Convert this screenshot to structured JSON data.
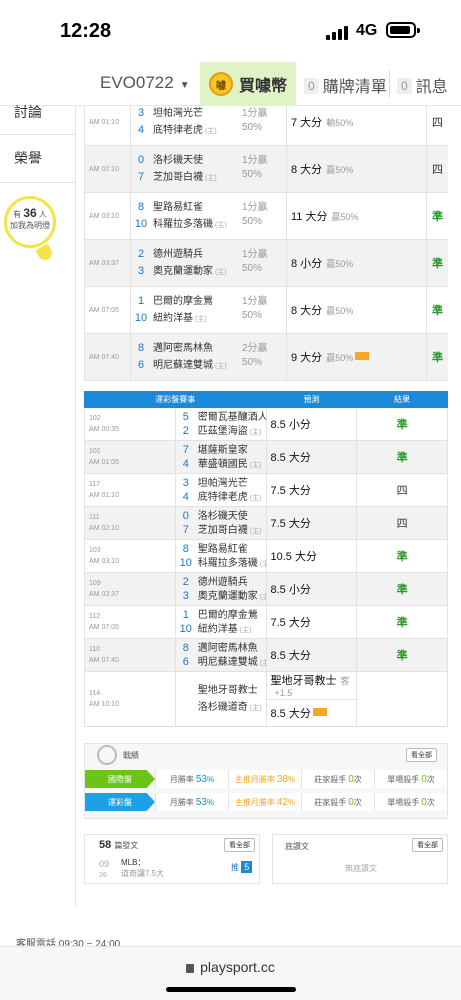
{
  "status_bar": {
    "time": "12:28",
    "network": "4G"
  },
  "top_nav": {
    "user_id": "EVO0722",
    "buy_coin_label": "買噱幣",
    "coin_glyph": "噱",
    "purchase_list": {
      "count": "0",
      "label": "購牌清單"
    },
    "messages": {
      "count": "0",
      "label": "訊息"
    }
  },
  "sidebar": {
    "links": [
      "討論",
      "榮譽"
    ],
    "fans_prefix": "有",
    "fans_count": "36",
    "fans_unit": "人",
    "fans_text": "加我為明燈"
  },
  "upper_games": [
    {
      "time": "AM 01:10",
      "away_num": "3",
      "away": "坦帕灣光芒",
      "home_num": "4",
      "home": "底特律老虎",
      "home_tag": "(主)",
      "odds": "1分贏\n50%",
      "pick": "7 大分",
      "pick_result": "輸50%",
      "hot": false,
      "result": "四",
      "result_color": "dark",
      "alt": false
    },
    {
      "time": "AM 02:10",
      "away_num": "0",
      "away": "洛杉磯天使",
      "home_num": "7",
      "home": "芝加哥白襪",
      "home_tag": "(主)",
      "odds": "1分贏\n50%",
      "pick": "8 大分",
      "pick_result": "贏50%",
      "hot": false,
      "result": "四",
      "result_color": "dark",
      "alt": true
    },
    {
      "time": "AM 03:10",
      "away_num": "8",
      "away": "聖路易紅雀",
      "home_num": "10",
      "home": "科羅拉多落磯",
      "home_tag": "(主)",
      "odds": "1分贏\n50%",
      "pick": "11 大分",
      "pick_result": "贏50%",
      "hot": false,
      "result": "準",
      "result_color": "green",
      "alt": false
    },
    {
      "time": "AM 03:37",
      "away_num": "2",
      "away": "德州遊騎兵",
      "home_num": "3",
      "home": "奧克蘭運動家",
      "home_tag": "(主)",
      "odds": "1分贏\n50%",
      "pick": "8 小分",
      "pick_result": "贏50%",
      "hot": false,
      "result": "準",
      "result_color": "green",
      "alt": true
    },
    {
      "time": "AM 07:05",
      "away_num": "1",
      "away": "巴爾的摩金鶯",
      "home_num": "10",
      "home": "紐約洋基",
      "home_tag": "(主)",
      "odds": "1分贏\n50%",
      "pick": "8 大分",
      "pick_result": "贏50%",
      "hot": false,
      "result": "準",
      "result_color": "green",
      "alt": false
    },
    {
      "time": "AM 07:40",
      "away_num": "8",
      "away": "邁阿密馬林魚",
      "home_num": "6",
      "home": "明尼蘇達雙城",
      "home_tag": "(主)",
      "odds": "2分贏\n50%",
      "pick": "9 大分",
      "pick_result": "贏50%",
      "hot": true,
      "result": "準",
      "result_color": "green",
      "alt": true
    }
  ],
  "lottery_table": {
    "header_games": "運彩盤賽事",
    "header_pick": "預測",
    "header_result": "結果",
    "rows": [
      {
        "no": "102",
        "time": "AM 00:35",
        "away_num": "5",
        "away": "密爾瓦基釀酒人",
        "home_num": "2",
        "home": "匹茲堡海盜",
        "pick": "8.5 小分",
        "hot": false,
        "result": "準",
        "result_color": "green",
        "alt": false
      },
      {
        "no": "101",
        "time": "AM 01:05",
        "away_num": "7",
        "away": "堪薩斯皇家",
        "home_num": "4",
        "home": "華盛頓國民",
        "pick": "8.5 大分",
        "hot": false,
        "result": "準",
        "result_color": "green",
        "alt": true
      },
      {
        "no": "117",
        "time": "AM 01:10",
        "away_num": "3",
        "away": "坦帕灣光芒",
        "home_num": "4",
        "home": "底特律老虎",
        "pick": "7.5 大分",
        "hot": false,
        "result": "四",
        "result_color": "dark",
        "alt": false
      },
      {
        "no": "111",
        "time": "AM 02:10",
        "away_num": "0",
        "away": "洛杉磯天使",
        "home_num": "7",
        "home": "芝加哥白襪",
        "pick": "7.5 大分",
        "hot": false,
        "result": "四",
        "result_color": "dark",
        "alt": true
      },
      {
        "no": "103",
        "time": "AM 03:10",
        "away_num": "8",
        "away": "聖路易紅雀",
        "home_num": "10",
        "home": "科羅拉多落磯",
        "pick": "10.5 大分",
        "hot": false,
        "result": "準",
        "result_color": "green",
        "alt": false
      },
      {
        "no": "109",
        "time": "AM 03:37",
        "away_num": "2",
        "away": "德州遊騎兵",
        "home_num": "3",
        "home": "奧克蘭運動家",
        "pick": "8.5 小分",
        "hot": false,
        "result": "準",
        "result_color": "green",
        "alt": true
      },
      {
        "no": "112",
        "time": "AM 07:05",
        "away_num": "1",
        "away": "巴爾的摩金鶯",
        "home_num": "10",
        "home": "紐約洋基",
        "pick": "7.5 大分",
        "hot": false,
        "result": "準",
        "result_color": "green",
        "alt": false
      },
      {
        "no": "110",
        "time": "AM 07:40",
        "away_num": "8",
        "away": "邁阿密馬林魚",
        "home_num": "6",
        "home": "明尼蘇達雙城",
        "pick": "8.5 大分",
        "hot": false,
        "result": "準",
        "result_color": "green",
        "alt": true
      }
    ],
    "last_row": {
      "no": "114",
      "time": "AM 10:10",
      "away": "聖地牙哥教士",
      "home": "洛杉磯道奇",
      "pick1": "聖地牙哥教士",
      "pick1_tag": "客",
      "pick1_line": "+1.5",
      "pick2": "8.5 大分"
    }
  },
  "stats": {
    "title": "戰績",
    "see_all": "看全部",
    "rows": [
      {
        "label": "國際盤",
        "color": "#6cc417",
        "month_win_label": "月勝率",
        "month_win": "53",
        "main_win_label": "主推月勝率",
        "main_win": "38",
        "banker_label": "莊家殺手",
        "banker": "0",
        "banker_unit": "次",
        "single_label": "單場殺手",
        "single": "0",
        "single_unit": "次"
      },
      {
        "label": "運彩盤",
        "color": "#1ea0e6",
        "month_win_label": "月勝率",
        "month_win": "53",
        "main_win_label": "主推月勝率",
        "main_win": "42",
        "banker_label": "莊家殺手",
        "banker": "0",
        "banker_unit": "次",
        "single_label": "單場殺手",
        "single": "0",
        "single_unit": "次"
      }
    ]
  },
  "left_card": {
    "count": "58",
    "title": "篇發文",
    "see_all": "看全部",
    "date_month": "09",
    "date_day": "26",
    "post_league": "MLB：",
    "post_text": "道奇讓7.5大",
    "post_tag": "推",
    "post_count": "5"
  },
  "right_card": {
    "title": "底讚文",
    "see_all": "看全部",
    "empty": "無底讚文"
  },
  "footer": {
    "service": "客服電話 09:30 ~ 24:00",
    "url": "playsport.cc"
  }
}
